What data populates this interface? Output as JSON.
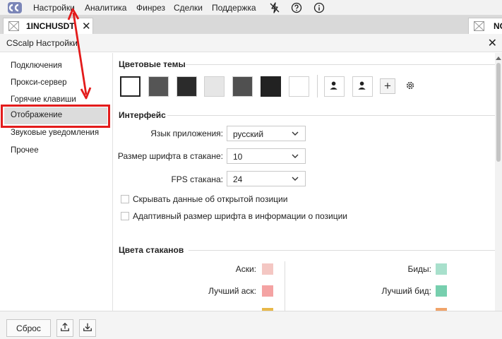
{
  "menu": {
    "items": [
      "Настройки",
      "Аналитика",
      "Финрез",
      "Сделки",
      "Поддержка"
    ]
  },
  "tabs": {
    "active": {
      "label": "1INCHUSDT"
    },
    "second": {
      "label": "NC"
    }
  },
  "window": {
    "title": "CScalp Настройки"
  },
  "sidebar": {
    "items": [
      {
        "label": "Подключения"
      },
      {
        "label": "Прокси-сервер"
      },
      {
        "label": "Горячие клавиши"
      },
      {
        "label": "Отображение"
      },
      {
        "label": "Звуковые уведомления"
      },
      {
        "label": "Прочее"
      }
    ]
  },
  "themes": {
    "title": "Цветовые темы",
    "swatches": [
      "#ffffff",
      "#555555",
      "#2b2b2b",
      "#e6e6e6",
      "#505050",
      "#222222",
      "#ffffff"
    ]
  },
  "interface": {
    "title": "Интерфейс",
    "language": {
      "label": "Язык приложения:",
      "value": "русский"
    },
    "font_size": {
      "label": "Размер шрифта в стакане:",
      "value": "10"
    },
    "fps": {
      "label": "FPS стакана:",
      "value": "24"
    },
    "hide_position": {
      "label": "Скрывать данные об открытой позиции"
    },
    "adaptive_font": {
      "label": "Адаптивный размер шрифта в информации о позиции"
    }
  },
  "book_colors": {
    "title": "Цвета стаканов",
    "asks": {
      "label": "Аски:",
      "color": "#f4c7c3"
    },
    "best_ask": {
      "label": "Лучший аск:",
      "color": "#f4a3a3"
    },
    "bids": {
      "label": "Биды:",
      "color": "#a8e0cc"
    },
    "best_bid": {
      "label": "Лучший бид:",
      "color": "#77cfae"
    },
    "partial_left_color": "#e8b84a",
    "partial_right_color": "#f0a46a"
  },
  "footer": {
    "reset_label": "Сброс"
  },
  "colors": {
    "annotation_red": "#e31b1b"
  }
}
